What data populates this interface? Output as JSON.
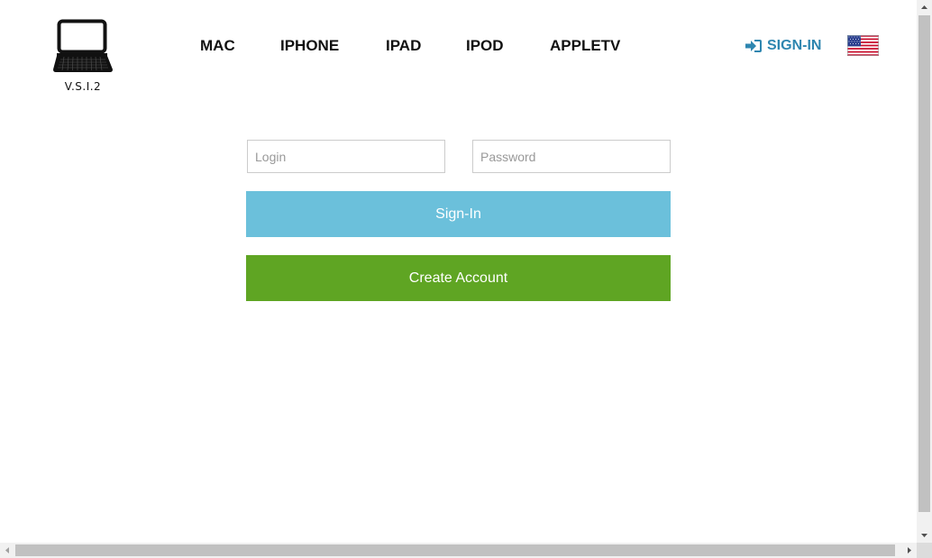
{
  "brand": {
    "logo_icon": "laptop-icon",
    "version": "V.S.I.2"
  },
  "nav": {
    "items": [
      {
        "label": "MAC"
      },
      {
        "label": "IPHONE"
      },
      {
        "label": "IPAD"
      },
      {
        "label": "IPOD"
      },
      {
        "label": "APPLETV"
      }
    ]
  },
  "header": {
    "signin_label": "SIGN-IN",
    "signin_icon": "sign-in-icon",
    "language_flag": "us-flag-icon"
  },
  "form": {
    "login_placeholder": "Login",
    "login_value": "",
    "password_placeholder": "Password",
    "password_value": "",
    "signin_button": "Sign-In",
    "create_account_button": "Create Account"
  },
  "colors": {
    "accent": "#2e86b0",
    "signin_button_bg": "#6bc0db",
    "create_button_bg": "#5fa523",
    "field_border": "#cccccc"
  }
}
